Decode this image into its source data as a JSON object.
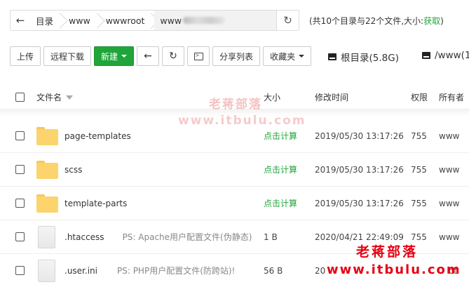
{
  "pathbar": {
    "crumbs": [
      "目录",
      "www",
      "wwwroot",
      "www"
    ],
    "summary_prefix": "(共10个目录与22个文件,大小:",
    "summary_link": "获取",
    "summary_suffix": ")"
  },
  "toolbar": {
    "upload": "上传",
    "remote_download": "远程下载",
    "new": "新建",
    "share_list": "分享列表",
    "favorites": "收藏夹",
    "disk_root": "根目录(5.8G)",
    "disk_www": "/www(1"
  },
  "table": {
    "headers": {
      "name": "文件名",
      "size": "大小",
      "time": "修改时间",
      "perm": "权限",
      "owner": "所有者"
    },
    "rows": [
      {
        "type": "folder",
        "name": "page-templates",
        "note": "",
        "size": "点击计算",
        "time": "2019/05/30 13:17:26",
        "perm": "755",
        "owner": "www"
      },
      {
        "type": "folder",
        "name": "scss",
        "note": "",
        "size": "点击计算",
        "time": "2019/05/30 13:17:26",
        "perm": "755",
        "owner": "www"
      },
      {
        "type": "folder",
        "name": "template-parts",
        "note": "",
        "size": "点击计算",
        "time": "2019/05/30 13:17:26",
        "perm": "755",
        "owner": "www"
      },
      {
        "type": "file",
        "name": ".htaccess",
        "note": "PS: Apache用户配置文件(伪静态)",
        "size": "1 B",
        "time": "2020/04/21 22:49:09",
        "perm": "755",
        "owner": "www"
      },
      {
        "type": "file",
        "name": ".user.ini",
        "note": "PS: PHP用户配置文件(防跨站)!",
        "size": "56 B",
        "time": "20",
        "perm": "",
        "owner": "ot"
      }
    ]
  },
  "watermark": {
    "top_cn": "老蒋部落",
    "top_url": "www.itbulu.com",
    "bottom_cn": "老蒋部落",
    "bottom_url": "www.itbulu.com"
  }
}
